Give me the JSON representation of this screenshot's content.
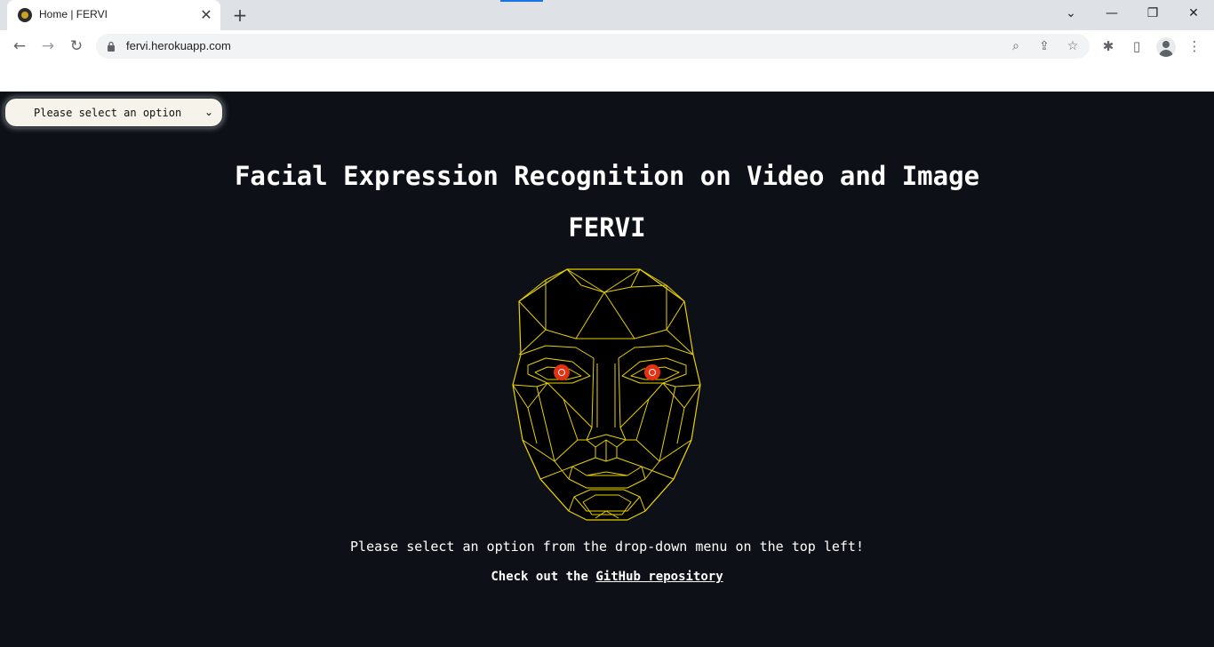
{
  "browser": {
    "tab": {
      "title": "Home | FERVI"
    },
    "address_bar": {
      "url": "fervi.herokuapp.com"
    }
  },
  "page": {
    "select": {
      "selected": "Please select an option"
    },
    "title": "Facial Expression Recognition on Video and Image",
    "subtitle": "FERVI",
    "prompt": "Please select an option from the drop-down menu on the top left!",
    "repo_prefix": "Check out the ",
    "repo_link": "GitHub repository"
  },
  "colors": {
    "page_background": "#0d1117",
    "face_lines": "#e8d000",
    "eyes": "#e53012"
  },
  "icons": {
    "tab_favicon": "fervi-favicon-icon",
    "tab_close": "close-icon",
    "new_tab": "plus-icon",
    "back": "back-arrow-icon",
    "forward": "forward-arrow-icon",
    "reload": "reload-icon",
    "lock": "lock-icon",
    "zoom": "zoom-icon",
    "share": "share-icon",
    "bookmark": "star-icon",
    "extensions": "puzzle-icon",
    "side_panel": "side-panel-icon",
    "profile": "profile-icon",
    "menu": "kebab-menu-icon"
  }
}
